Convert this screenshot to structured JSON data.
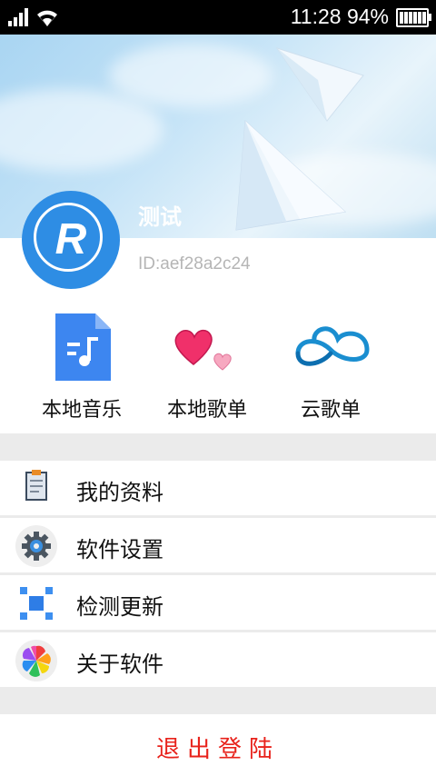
{
  "status_bar": {
    "time": "11:28",
    "battery": "94%"
  },
  "profile": {
    "username": "测试",
    "user_id": "ID:aef28a2c24",
    "avatar_letter": "R"
  },
  "quick_access": [
    {
      "label": "本地音乐",
      "icon": "music-file-icon"
    },
    {
      "label": "本地歌单",
      "icon": "hearts-icon"
    },
    {
      "label": "云歌单",
      "icon": "cloud-infinity-icon"
    }
  ],
  "menu": [
    {
      "label": "我的资料",
      "icon": "clipboard-icon"
    },
    {
      "label": "软件设置",
      "icon": "gear-icon"
    },
    {
      "label": "检测更新",
      "icon": "update-squares-icon"
    },
    {
      "label": "关于软件",
      "icon": "pinwheel-icon"
    }
  ],
  "logout_label": "退出登陆",
  "colors": {
    "accent": "#2e8de4",
    "logout": "#e8221b"
  }
}
